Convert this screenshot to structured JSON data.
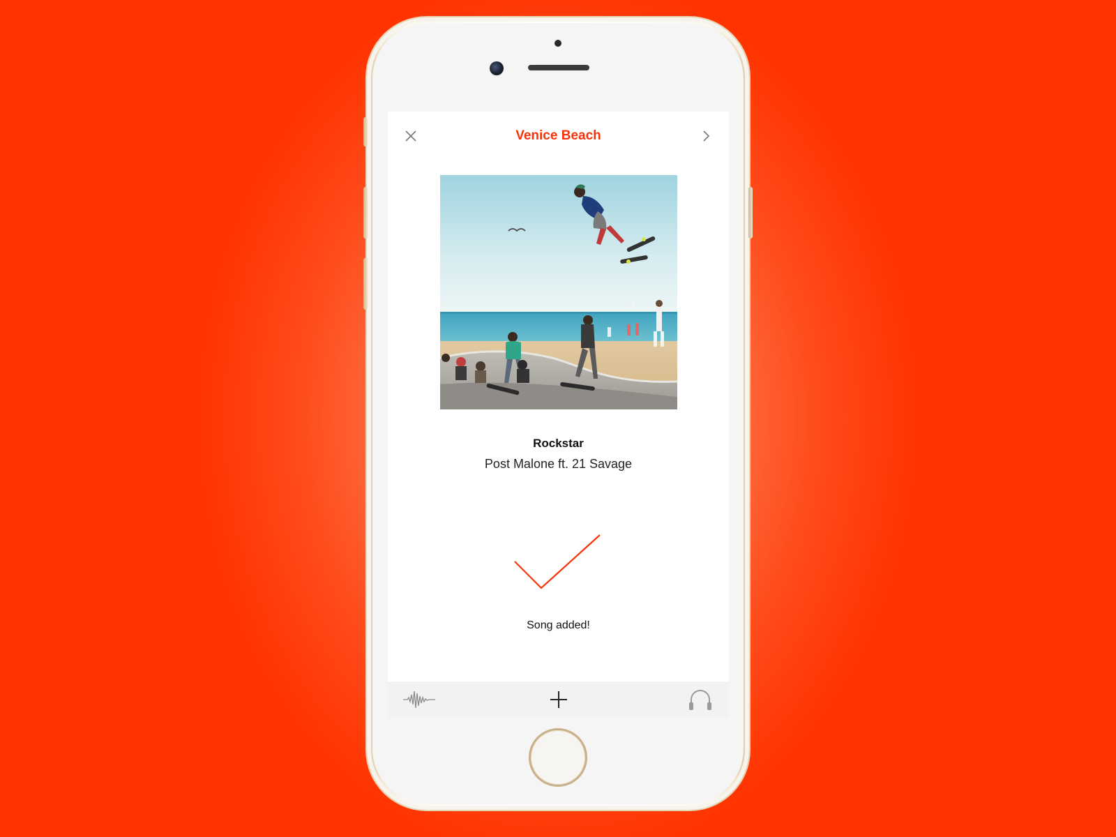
{
  "nav": {
    "title": "Venice Beach",
    "close_icon": "close-icon",
    "next_icon": "chevron-right-icon"
  },
  "track": {
    "title": "Rockstar",
    "artist": "Post Malone ft. 21 Savage"
  },
  "status": {
    "message": "Song added!",
    "icon": "checkmark-icon"
  },
  "tabbar": {
    "items": [
      {
        "icon": "waveform-icon"
      },
      {
        "icon": "plus-icon"
      },
      {
        "icon": "headphones-icon"
      }
    ]
  },
  "colors": {
    "accent": "#f5340e",
    "background": "#ff3a0a"
  }
}
